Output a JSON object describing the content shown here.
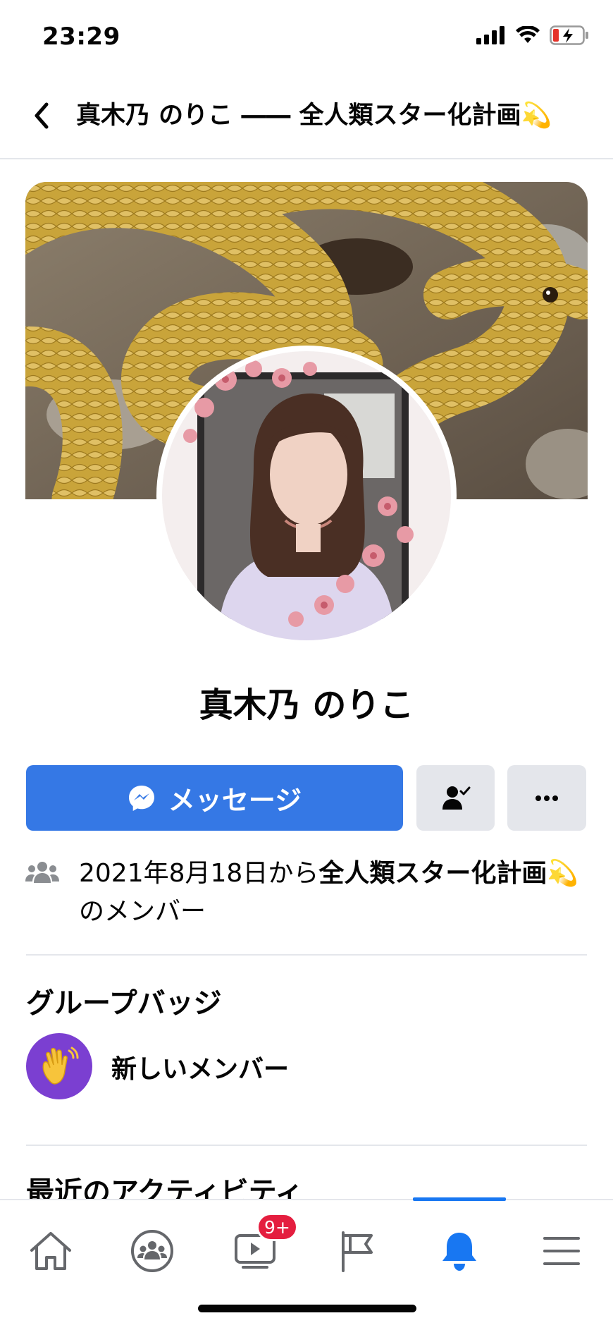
{
  "status": {
    "time": "23:29"
  },
  "header": {
    "title": "真木乃 のりこ ―― 全人類スター化計画💫"
  },
  "profile": {
    "name": "真木乃 のりこ"
  },
  "actions": {
    "message_label": "メッセージ"
  },
  "membership": {
    "prefix": "2021年8月18日から",
    "group": "全人類スター化計画💫",
    "suffix": "のメンバー"
  },
  "badges": {
    "title": "グループバッジ",
    "items": [
      {
        "label": "新しいメンバー",
        "icon": "waving-hand-icon"
      }
    ]
  },
  "activity": {
    "title": "最近のアクティビティ"
  },
  "tabbar": {
    "items": [
      "home-icon",
      "groups-icon",
      "watch-icon",
      "pages-icon",
      "notifications-icon",
      "menu-icon"
    ],
    "watch_badge": "9+",
    "active": "notifications",
    "accent": "#1877f2"
  },
  "colors": {
    "primary_button": "#3578e5",
    "secondary_button": "#e4e6eb",
    "badge_bg": "#7b3fd1"
  }
}
